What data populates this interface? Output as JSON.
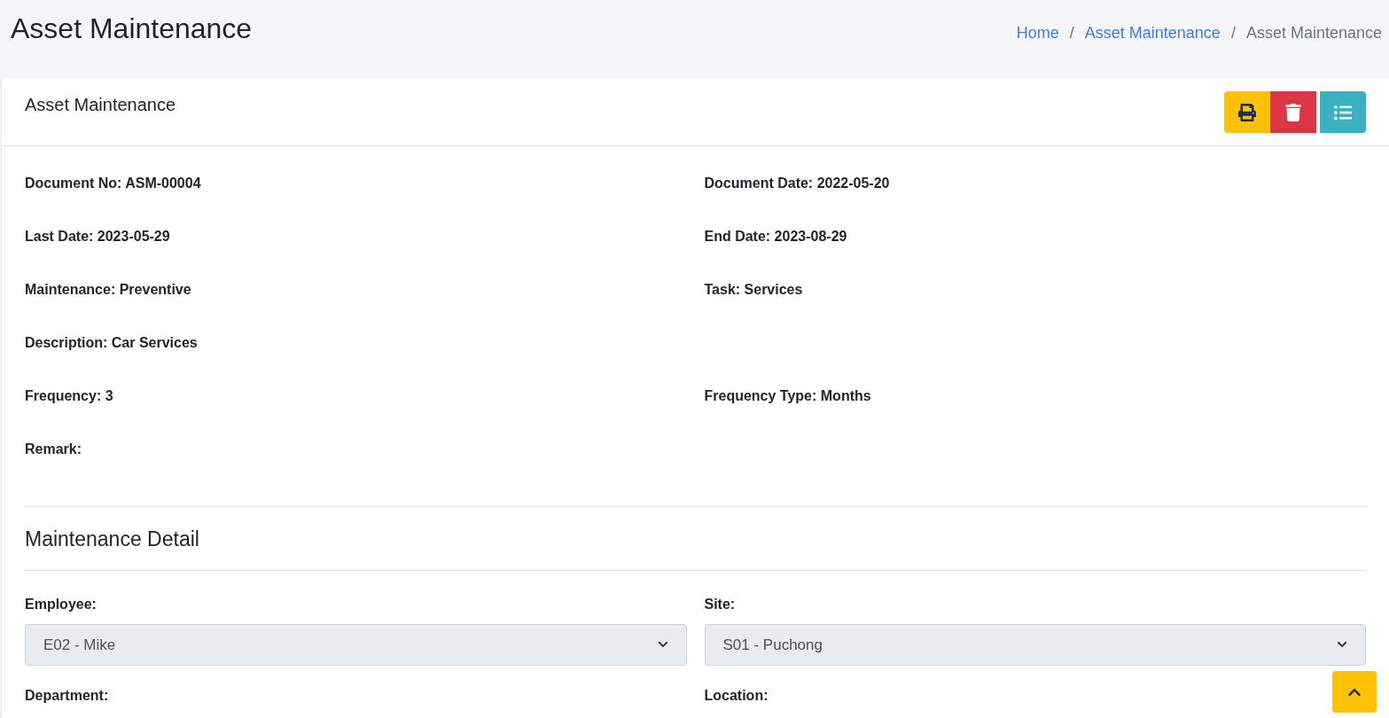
{
  "page_title": "Asset Maintenance",
  "breadcrumb": [
    {
      "label": "Home",
      "active": false
    },
    {
      "separator": "/",
      "label": "Asset Maintenance",
      "active": false
    },
    {
      "separator": "/",
      "label": "Asset Maintenance",
      "active": true
    }
  ],
  "card": {
    "title": "Asset Maintenance",
    "tools": [
      {
        "kind": "print"
      },
      {
        "kind": "delete"
      },
      {
        "kind": "list"
      }
    ],
    "info_rows": [
      [
        {
          "label": "Document No:",
          "value": "ASM-00004"
        },
        {
          "label": "Document Date:",
          "value": "2022-05-20"
        }
      ],
      [
        {
          "label": "Last Date:",
          "value": "2023-05-29"
        },
        {
          "label": "End Date:",
          "value": "2023-08-29"
        }
      ],
      [
        {
          "label": "Maintenance:",
          "value": "Preventive"
        },
        {
          "label": "Task:",
          "value": "Services"
        }
      ],
      [
        {
          "label": "Description:",
          "value": "Car Services"
        }
      ],
      [
        {
          "label": "Frequency:",
          "value": "3"
        },
        {
          "label": "Frequency Type:",
          "value": "Months"
        }
      ],
      [
        {
          "label": "Remark:"
        }
      ]
    ],
    "section_title": "Maintenance Detail",
    "detail_fields": [
      {
        "label": "Employee:",
        "value": "E02 - Mike"
      },
      {
        "label": "Site:",
        "value": "S01 - Puchong"
      },
      {
        "label": "Department:"
      },
      {
        "label": "Location:"
      }
    ]
  }
}
